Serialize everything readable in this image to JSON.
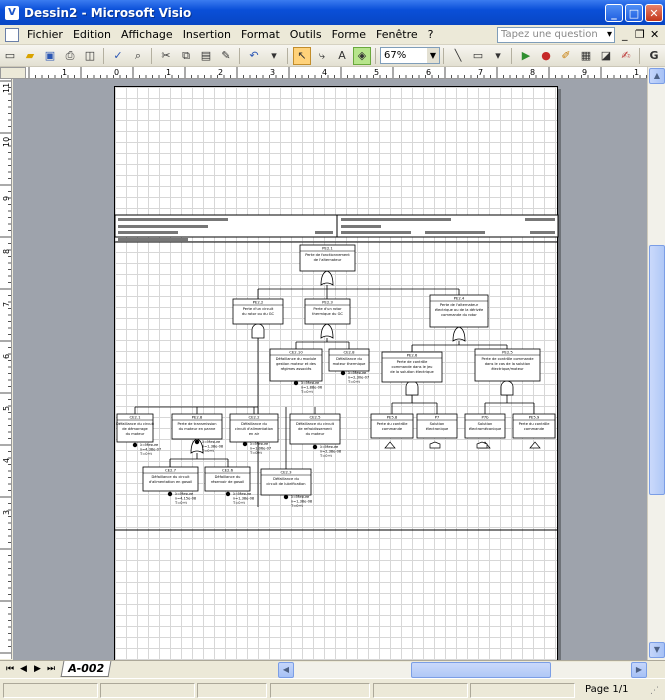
{
  "window": {
    "title": "Dessin2 - Microsoft Visio",
    "app_icon": "V"
  },
  "menu": {
    "items": [
      "Fichier",
      "Edition",
      "Affichage",
      "Insertion",
      "Format",
      "Outils",
      "Forme",
      "Fenêtre",
      "?"
    ],
    "ask_placeholder": "Tapez une question"
  },
  "toolbar": {
    "zoom": "67%",
    "font_button": "A"
  },
  "rulers": {
    "h_labels": [
      "1",
      "0",
      "1",
      "2",
      "3",
      "4",
      "5",
      "6",
      "7",
      "8",
      "9",
      "1"
    ],
    "v_labels": [
      "11",
      "10",
      "9",
      "8",
      "7",
      "6",
      "5",
      "4",
      "3"
    ]
  },
  "diagram": {
    "nodes": [
      {
        "id": "PE2.1",
        "l1": "Perte de fonctionnement",
        "l2": "de l'alternateur",
        "l3": ""
      },
      {
        "id": "PE2.2",
        "l1": "Perte d'un circuit",
        "l2": "du rotor ou du GC",
        "l3": ""
      },
      {
        "id": "PE2.3",
        "l1": "Perte d'un rotor",
        "l2": "thermique du GC",
        "l3": ""
      },
      {
        "id": "PE2.4",
        "l1": "Perte de l'alternateur",
        "l2": "électrique ou de la dérivée",
        "l3": "commande du rotor"
      },
      {
        "id": "CE2.10",
        "l1": "Défaillance du module",
        "l2": "gestion moteur et des",
        "l3": "régimes associés"
      },
      {
        "id": "CE2.8",
        "l1": "Défaillance du",
        "l2": "moteur thermique",
        "l3": ""
      },
      {
        "id": "PE2.6",
        "l1": "Perte de contrôle",
        "l2": "commande dans le jeu",
        "l3": "de la solution électrique"
      },
      {
        "id": "PE2.5",
        "l1": "Perte de contrôle commande",
        "l2": "dans le cas de la solution",
        "l3": "électrique/moteur"
      },
      {
        "id": "CE2.1",
        "l1": "Défaillance du circuit",
        "l2": "de démarrage",
        "l3": "du moteur"
      },
      {
        "id": "PE2.8",
        "l1": "Perte de transmission",
        "l2": "du moteur en panne",
        "l3": ""
      },
      {
        "id": "CE2.2",
        "l1": "Défaillance du",
        "l2": "circuit d'alimentation",
        "l3": "en air"
      },
      {
        "id": "CE2.5",
        "l1": "Défaillance du circuit",
        "l2": "de refroidissement",
        "l3": "du moteur"
      },
      {
        "id": "CE2.7",
        "l1": "Défaillance du circuit",
        "l2": "d'alimentation en gasoil",
        "l3": ""
      },
      {
        "id": "CE2.6",
        "l1": "Défaillance du",
        "l2": "réservoir de gasoil",
        "l3": ""
      },
      {
        "id": "CE2.3",
        "l1": "Défaillance du",
        "l2": "circuit de lubrification",
        "l3": ""
      },
      {
        "id": "PE5.8",
        "l1": "Perte du contrôle",
        "l2": "commande",
        "l3": ""
      },
      {
        "id": "P7",
        "l1": "Solution",
        "l2": "électronique",
        "l3": ""
      },
      {
        "id": "P7b",
        "l1": "Solution",
        "l2": "électromécanique",
        "l3": ""
      },
      {
        "id": "PE5.9",
        "l1": "Perte du contrôle",
        "l2": "commande",
        "l3": ""
      }
    ],
    "rates": [
      {
        "a": "λ=Mesure",
        "b": "λ=4,38e-07",
        "c": "T=0+t"
      },
      {
        "a": "λ=Mesure",
        "b": "λ=1,88e-06",
        "c": "T=0+t"
      },
      {
        "a": "λ=Mesure",
        "b": "λ=2,30e-07",
        "c": "T=0+t"
      },
      {
        "a": "λ=Mesure",
        "b": "λ=1,06e-07",
        "c": "T=0+t"
      },
      {
        "a": "λ=Mesure",
        "b": "λ=2,38e-08",
        "c": "T=0+t"
      },
      {
        "a": "λ=Mesure",
        "b": "λ=4,15e-08",
        "c": "T=0+t"
      },
      {
        "a": "λ=Mesure",
        "b": "λ=1,38e-08",
        "c": "T=0+t"
      },
      {
        "a": "λ=Mesure",
        "b": "λ=1,38e-08",
        "c": "T=0+t"
      },
      {
        "a": "λ=Mesure",
        "b": "λ=1,38e-08",
        "c": "T=0+t"
      }
    ]
  },
  "sheet_tab": "A-002",
  "status": {
    "page": "Page 1/1"
  }
}
